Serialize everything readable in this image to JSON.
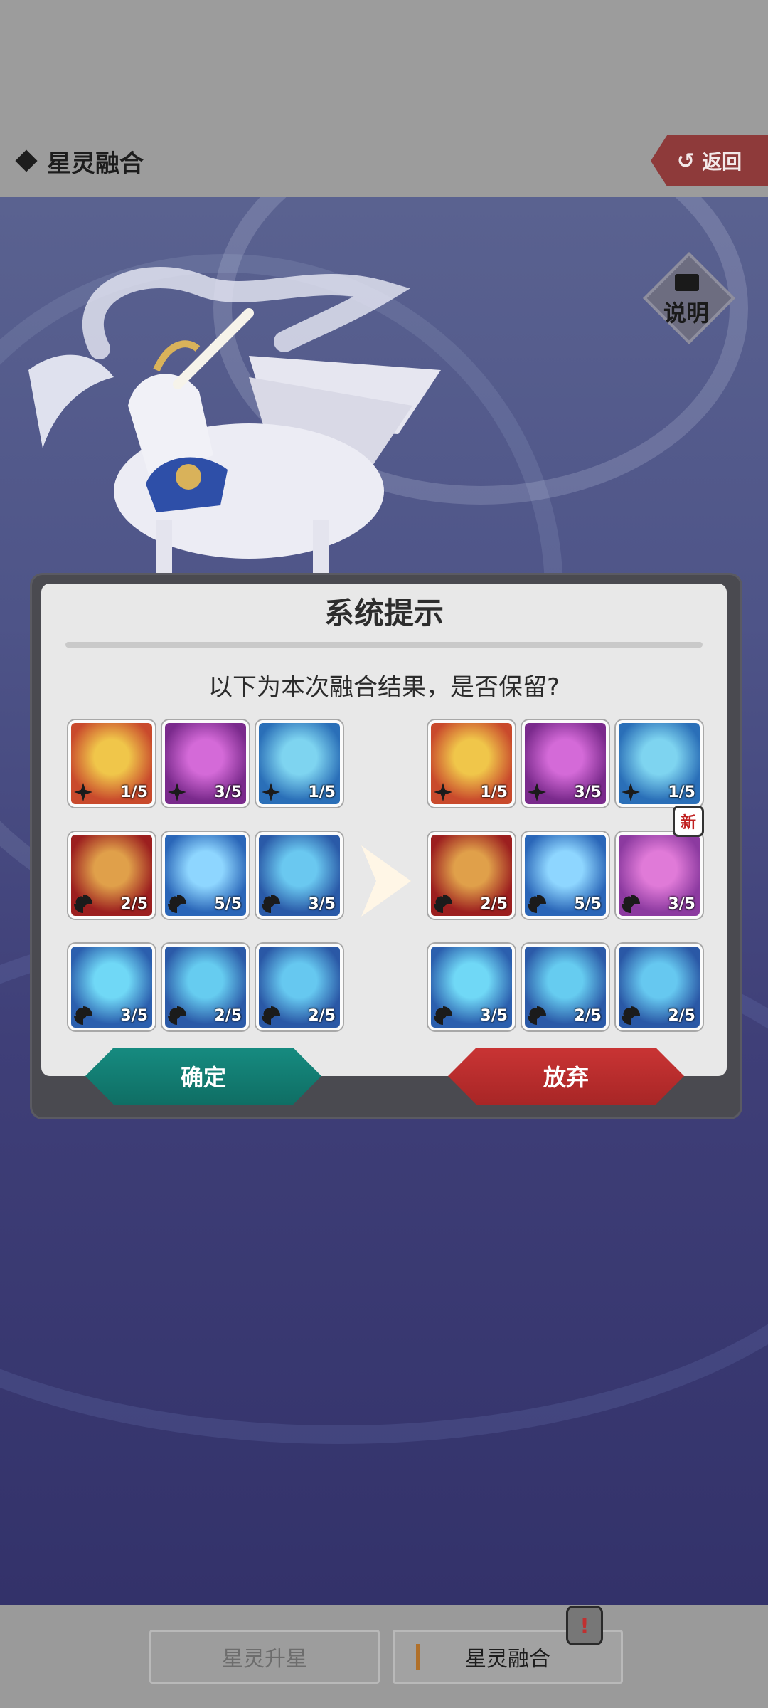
{
  "header": {
    "title": "星灵融合",
    "back_label": "返回"
  },
  "help": {
    "label": "说明"
  },
  "dialog": {
    "title": "系统提示",
    "message": "以下为本次融合结果，是否保留?",
    "confirm_label": "确定",
    "abandon_label": "放弃",
    "new_badge": "新"
  },
  "skills_before": [
    {
      "icon": "sun-emblem-icon",
      "level": "1/5",
      "type": "star"
    },
    {
      "icon": "purple-shield-icon",
      "level": "3/5",
      "type": "star"
    },
    {
      "icon": "blue-burst-icon",
      "level": "1/5",
      "type": "star"
    },
    {
      "icon": "scroll-buff-icon",
      "level": "2/5",
      "type": "swirl"
    },
    {
      "icon": "blue-crash-icon",
      "level": "5/5",
      "type": "swirl"
    },
    {
      "icon": "shield-up-icon",
      "level": "3/5",
      "type": "swirl"
    },
    {
      "icon": "shield-snowflake-icon",
      "level": "3/5",
      "type": "swirl"
    },
    {
      "icon": "shield-sun-icon",
      "level": "2/5",
      "type": "swirl"
    },
    {
      "icon": "shield-flame-icon",
      "level": "2/5",
      "type": "swirl"
    }
  ],
  "skills_after": [
    {
      "icon": "sun-emblem-icon",
      "level": "1/5",
      "type": "star"
    },
    {
      "icon": "purple-shield-icon",
      "level": "3/5",
      "type": "star"
    },
    {
      "icon": "blue-burst-icon",
      "level": "1/5",
      "type": "star"
    },
    {
      "icon": "scroll-buff-icon",
      "level": "2/5",
      "type": "swirl"
    },
    {
      "icon": "blue-crash-icon",
      "level": "5/5",
      "type": "swirl"
    },
    {
      "icon": "heart-heal-icon",
      "level": "3/5",
      "type": "swirl"
    },
    {
      "icon": "shield-snowflake-icon",
      "level": "3/5",
      "type": "swirl"
    },
    {
      "icon": "shield-sun-icon",
      "level": "2/5",
      "type": "swirl"
    },
    {
      "icon": "shield-flame-icon",
      "level": "2/5",
      "type": "swirl"
    }
  ],
  "bottom_nav": {
    "tab1": "星灵升星",
    "tab2": "星灵融合",
    "alert": "!"
  }
}
